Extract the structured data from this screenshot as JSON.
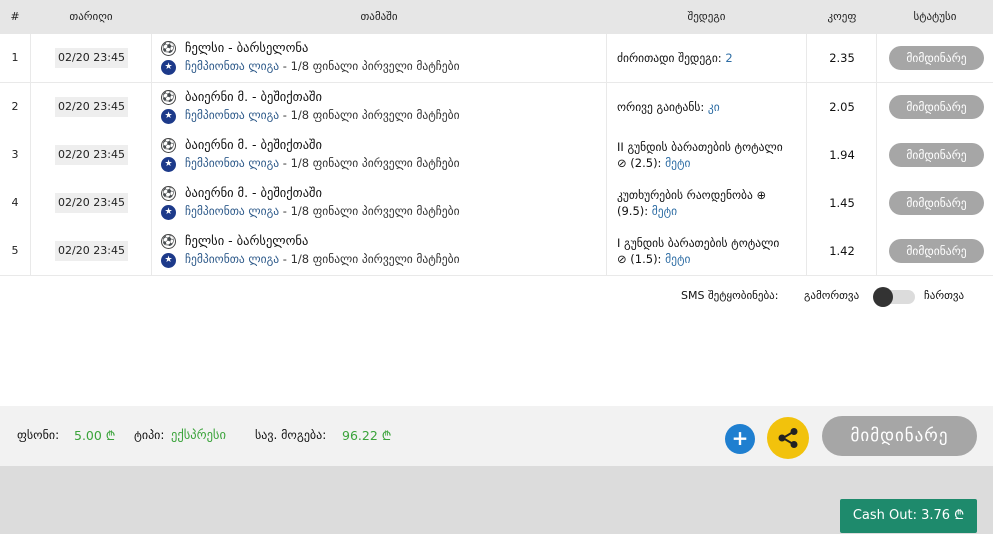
{
  "header": {
    "num": "#",
    "date": "თარიღი",
    "match": "თამაში",
    "market": "შედეგი",
    "odds": "კოეფ",
    "status": "სტატუსი"
  },
  "rows": [
    {
      "num": "1",
      "date": "02/20 23:45",
      "match": "ჩელსი - ბარსელონა",
      "league": "ჩემპიონთა ლიგა",
      "round": " - 1/8 ფინალი პირველი მატჩები",
      "market_line1": "ძირითადი შედეგი: ",
      "market_val1": "2",
      "market_line2": "",
      "market_val2": "",
      "odds": "2.35",
      "status": "მიმდინარე"
    },
    {
      "num": "2",
      "date": "02/20 23:45",
      "match": "ბაიერნი მ. - ბეშიქთაში",
      "league": "ჩემპიონთა ლიგა",
      "round": " - 1/8 ფინალი პირველი მატჩები",
      "market_line1": "ორივე გაიტანს: ",
      "market_val1": "კი",
      "market_line2": "",
      "market_val2": "",
      "odds": "2.05",
      "status": "მიმდინარე"
    },
    {
      "num": "3",
      "date": "02/20 23:45",
      "match": "ბაიერნი მ. - ბეშიქთაში",
      "league": "ჩემპიონთა ლიგა",
      "round": " - 1/8 ფინალი პირველი მატჩები",
      "market_line1": "II გუნდის ბარათების ტოტალი",
      "market_val1": "",
      "market_line2": "⊘ (2.5): ",
      "market_val2": "მეტი",
      "odds": "1.94",
      "status": "მიმდინარე"
    },
    {
      "num": "4",
      "date": "02/20 23:45",
      "match": "ბაიერნი მ. - ბეშიქთაში",
      "league": "ჩემპიონთა ლიგა",
      "round": " - 1/8 ფინალი პირველი მატჩები",
      "market_line1": "კუთხურების რაოდენობა ⊕",
      "market_val1": "",
      "market_line2": "(9.5): ",
      "market_val2": "მეტი",
      "odds": "1.45",
      "status": "მიმდინარე"
    },
    {
      "num": "5",
      "date": "02/20 23:45",
      "match": "ჩელსი - ბარსელონა",
      "league": "ჩემპიონთა ლიგა",
      "round": " - 1/8 ფინალი პირველი მატჩები",
      "market_line1": "I გუნდის ბარათების ტოტალი",
      "market_val1": "",
      "market_line2": "⊘ (1.5): ",
      "market_val2": "მეტი",
      "odds": "1.42",
      "status": "მიმდინარე"
    }
  ],
  "sms": {
    "label": "SMS შეტყობინება:",
    "off": "გამორთვა",
    "on": "ჩართვა"
  },
  "summary": {
    "stake_label": "ფსონი:",
    "stake_value": "5.00 ₾",
    "type_label": "ტიპი:",
    "type_value": "ექსპრესი",
    "win_label": "სავ. მოგება:",
    "win_value": "96.22 ₾",
    "add_symbol": "+",
    "status": "მიმდინარე"
  },
  "cashout": {
    "label": "Cash Out: 3.76 ₾"
  },
  "colors": {
    "accent_green": "#3aa33a",
    "link_blue": "#2e6da4",
    "status_grey": "#a6a6a6",
    "share_yellow": "#f2c20c",
    "add_blue": "#1f7fd0",
    "cashout_green": "#1e8a6c"
  },
  "icons": {
    "ball": "soccer-ball-icon",
    "league": "champions-league-icon",
    "share": "share-icon",
    "add": "plus-icon"
  }
}
